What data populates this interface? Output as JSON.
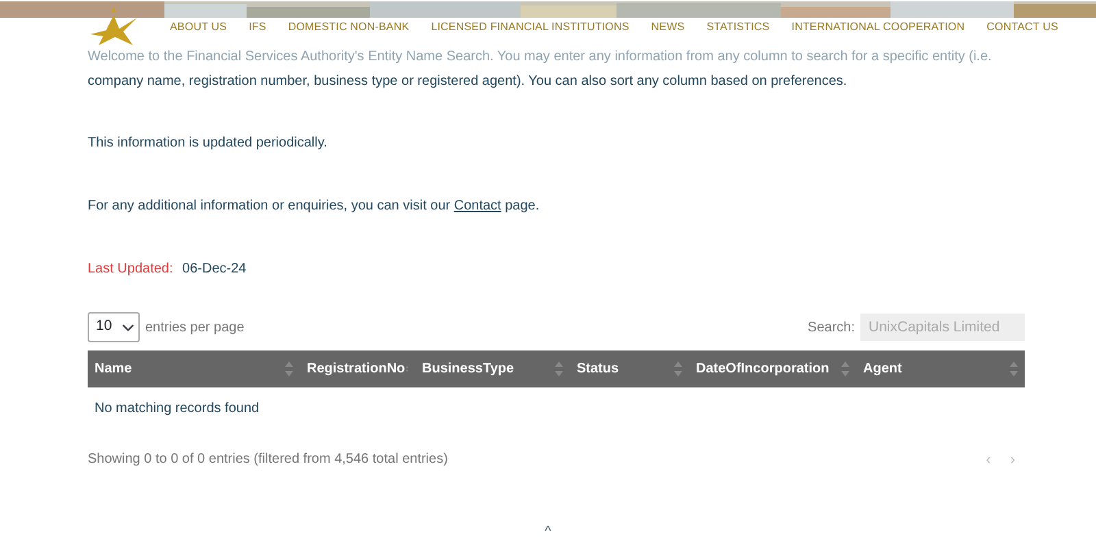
{
  "nav": {
    "items": [
      "ABOUT US",
      "IFS",
      "DOMESTIC NON-BANK",
      "LICENSED FINANCIAL INSTITUTIONS",
      "NEWS",
      "STATISTICS",
      "INTERNATIONAL COOPERATION",
      "CONTACT US"
    ]
  },
  "intro": {
    "lines": [
      {
        "text": "Welcome to the Financial Services Authority's Entity Name Search. You may enter any information from any column to search for a specific entity (i.e.",
        "faded": true
      },
      {
        "text": "company name, registration number, business type or registered agent). You can also sort any column based on preferences.",
        "faded": false
      }
    ],
    "update_note": "This information is updated periodically.",
    "contact_before": "For any additional information or enquiries, you can visit our",
    "contact_link": "Contact",
    "contact_after": "page."
  },
  "last_updated": {
    "label": "Last Updated:",
    "value": "06-Dec-24"
  },
  "table_controls": {
    "page_size": "10",
    "page_size_label": "entries per page",
    "search_label": "Search:",
    "search_value": "UnixCapitals Limited"
  },
  "table": {
    "columns": [
      "Name",
      "RegistrationNo",
      "BusinessType",
      "Status",
      "DateOfIncorporation",
      "Agent"
    ],
    "empty_message": "No matching records found"
  },
  "footer": {
    "info": "Showing 0 to 0 of 0 entries (filtered from 4,546 total entries)",
    "prev": "‹",
    "next": "›",
    "scroll_top": "^"
  }
}
